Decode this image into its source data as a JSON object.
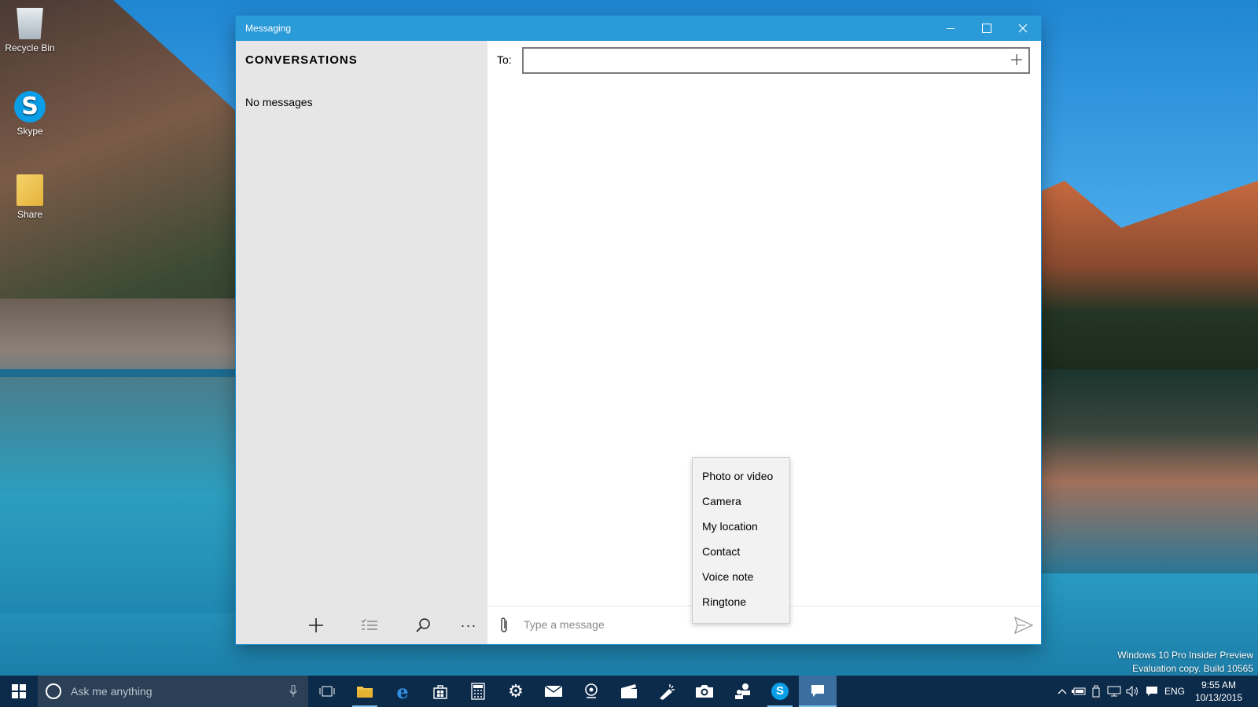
{
  "desktop": {
    "icons": [
      {
        "label": "Recycle Bin"
      },
      {
        "label": "Skype"
      },
      {
        "label": "Share"
      }
    ],
    "watermark": {
      "line1": "Windows 10 Pro Insider Preview",
      "line2": "Evaluation copy. Build 10565"
    }
  },
  "window": {
    "title": "Messaging",
    "controls": {
      "minimize": "minimize-icon",
      "maximize": "maximize-icon",
      "close": "close-icon"
    },
    "accent": "#2b9ad8"
  },
  "sidebar": {
    "heading": "CONVERSATIONS",
    "empty_text": "No messages",
    "appbar": [
      {
        "name": "new-message",
        "icon": "plus-icon"
      },
      {
        "name": "select",
        "icon": "checklist-icon"
      },
      {
        "name": "search",
        "icon": "search-icon"
      },
      {
        "name": "more",
        "icon": "more-icon",
        "glyph": "···"
      }
    ]
  },
  "main": {
    "to_label": "To:",
    "to_value": "",
    "composer": {
      "placeholder": "Type a message",
      "attach_icon": "paperclip-icon",
      "send_icon": "send-icon"
    }
  },
  "attach_menu": {
    "items": [
      "Photo or video",
      "Camera",
      "My location",
      "Contact",
      "Voice note",
      "Ringtone"
    ]
  },
  "taskbar": {
    "search_placeholder": "Ask me anything",
    "apps": [
      "task-view-icon",
      "file-explorer-icon",
      "edge-icon",
      "store-icon",
      "calculator-icon",
      "settings-icon",
      "mail-icon",
      "maps-icon",
      "movies-icon",
      "feedback-icon",
      "camera-icon",
      "people-icon",
      "skype-icon",
      "messaging-icon"
    ],
    "tray": {
      "language": "ENG",
      "time": "9:55 AM",
      "date": "10/13/2015"
    }
  }
}
